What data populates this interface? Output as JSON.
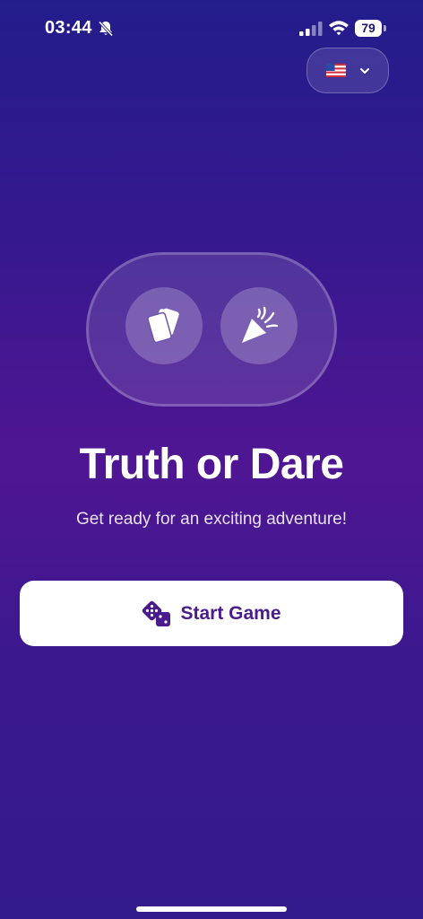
{
  "status_bar": {
    "time": "03:44",
    "battery_level": "79",
    "icons": [
      "bell-slash-icon",
      "signal-icon",
      "wifi-icon",
      "battery-icon"
    ]
  },
  "language_selector": {
    "flag": "us-flag-icon",
    "chevron": "chevron-down-icon"
  },
  "hero": {
    "left_icon": "cards-icon",
    "right_icon": "party-popper-icon"
  },
  "title": "Truth or Dare",
  "subtitle": "Get ready for an exciting adventure!",
  "start_button": {
    "label": "Start Game",
    "icon": "dice-icon"
  },
  "colors": {
    "background_top": "#231d8c",
    "background_mid": "#4f1693",
    "background_bottom": "#341b8d",
    "button_text": "#4a1b8c",
    "button_bg": "#ffffff"
  }
}
